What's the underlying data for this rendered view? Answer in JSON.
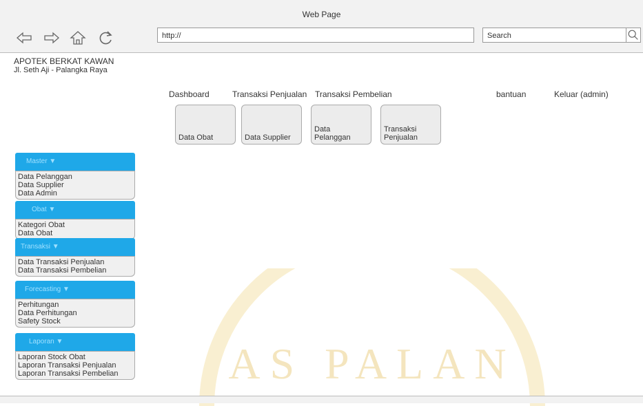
{
  "window": {
    "title": "Web Page"
  },
  "toolbar": {
    "url": "http://",
    "search_placeholder": "Search"
  },
  "brand": {
    "name": "APOTEK BERKAT KAWAN",
    "address": "Jl. Seth Aji - Palangka Raya"
  },
  "topnav": {
    "dashboard": "Dashboard",
    "transaksi_penjualan": "Transaksi Penjualan",
    "transaksi_pembelian": "Transaksi Pembelian",
    "bantuan": "bantuan",
    "keluar": "Keluar (admin)"
  },
  "tiles": [
    {
      "label": "Data Obat"
    },
    {
      "label": "Data Supplier"
    },
    {
      "label": "Data Pelanggan"
    },
    {
      "label": "Transaksi Penjualan"
    }
  ],
  "sidebar": [
    {
      "header": "Master ▼",
      "items": [
        "Data Pelanggan",
        "Data Supplier",
        "Data Admin"
      ]
    },
    {
      "header": "Obat ▼",
      "items": [
        "Kategori Obat",
        "Data Obat"
      ]
    },
    {
      "header": "Transaksi ▼",
      "items": [
        "Data Transaksi Penjualan",
        "Data Transaksi Pembelian"
      ]
    },
    {
      "header": "Forecasting ▼",
      "items": [
        "Perhitungan",
        "Data Perhitungan",
        "Safety Stock"
      ]
    },
    {
      "header": "Laporan ▼",
      "items": [
        "Laporan Stock Obat",
        "Laporan Transaksi Penjualan",
        "Laporan Transaksi Pembelian"
      ]
    }
  ],
  "watermark": {
    "text": "AS PALAN"
  },
  "colors": {
    "sidebar_header": "#1fa8e8",
    "watermark": "#e8c44a"
  }
}
